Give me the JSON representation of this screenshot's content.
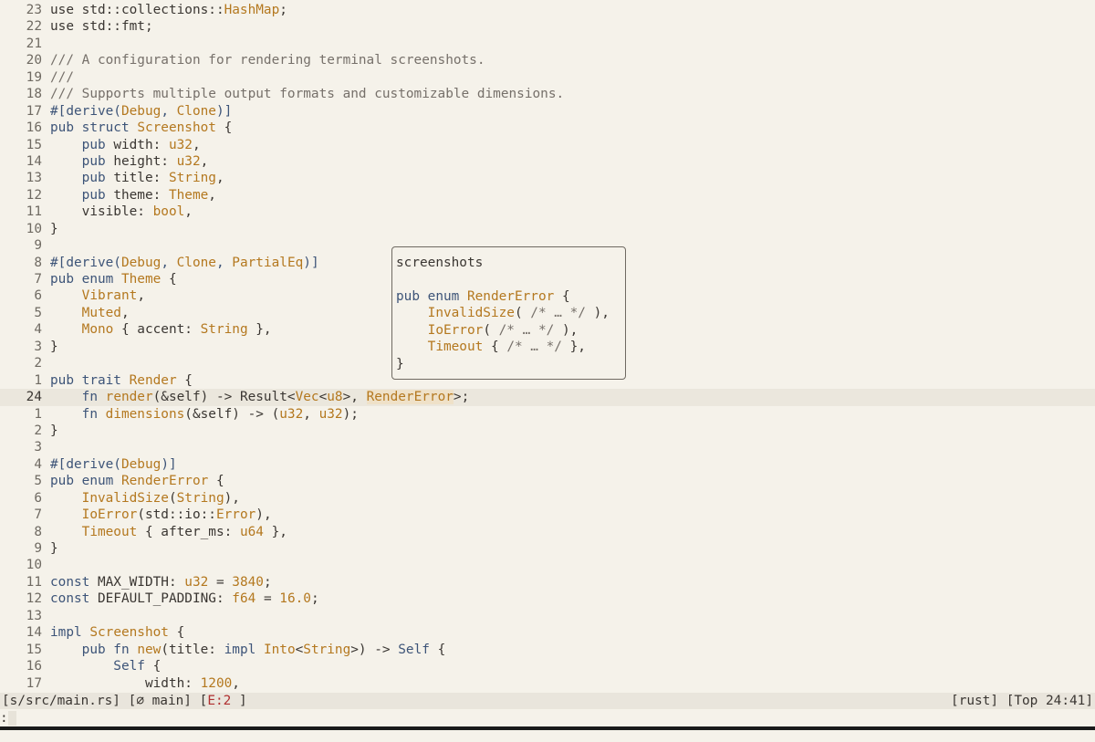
{
  "colors": {
    "background": "#f5f2ea",
    "keyword": "#3d5478",
    "type": "#b4781f",
    "comment": "#76706a",
    "current_line": "#ebe7dd",
    "statusline": "#e9e5dc",
    "error": "#b03030"
  },
  "editor": {
    "current_line_index": 23,
    "lines": [
      {
        "num": "23",
        "tokens": [
          {
            "t": "use std::collections::",
            "c": "plain"
          },
          {
            "t": "HashMap",
            "c": "type"
          },
          {
            "t": ";",
            "c": "plain"
          }
        ]
      },
      {
        "num": "22",
        "tokens": [
          {
            "t": "use std::fmt;",
            "c": "plain"
          }
        ]
      },
      {
        "num": "21",
        "tokens": []
      },
      {
        "num": "20",
        "tokens": [
          {
            "t": "/// A configuration for rendering terminal screenshots.",
            "c": "cmt"
          }
        ]
      },
      {
        "num": "19",
        "tokens": [
          {
            "t": "///",
            "c": "cmt"
          }
        ]
      },
      {
        "num": "18",
        "tokens": [
          {
            "t": "/// Supports multiple output formats and customizable dimensions.",
            "c": "cmt"
          }
        ]
      },
      {
        "num": "17",
        "tokens": [
          {
            "t": "#[derive(",
            "c": "kw"
          },
          {
            "t": "Debug",
            "c": "type"
          },
          {
            "t": ", ",
            "c": "kw"
          },
          {
            "t": "Clone",
            "c": "type"
          },
          {
            "t": ")]",
            "c": "kw"
          }
        ]
      },
      {
        "num": "16",
        "tokens": [
          {
            "t": "pub struct ",
            "c": "kw"
          },
          {
            "t": "Screenshot",
            "c": "type"
          },
          {
            "t": " {",
            "c": "plain"
          }
        ]
      },
      {
        "num": "15",
        "tokens": [
          {
            "t": "    pub ",
            "c": "kw"
          },
          {
            "t": "width: ",
            "c": "plain"
          },
          {
            "t": "u32",
            "c": "type"
          },
          {
            "t": ",",
            "c": "plain"
          }
        ]
      },
      {
        "num": "14",
        "tokens": [
          {
            "t": "    pub ",
            "c": "kw"
          },
          {
            "t": "height: ",
            "c": "plain"
          },
          {
            "t": "u32",
            "c": "type"
          },
          {
            "t": ",",
            "c": "plain"
          }
        ]
      },
      {
        "num": "13",
        "tokens": [
          {
            "t": "    pub ",
            "c": "kw"
          },
          {
            "t": "title: ",
            "c": "plain"
          },
          {
            "t": "String",
            "c": "type"
          },
          {
            "t": ",",
            "c": "plain"
          }
        ]
      },
      {
        "num": "12",
        "tokens": [
          {
            "t": "    pub ",
            "c": "kw"
          },
          {
            "t": "theme: ",
            "c": "plain"
          },
          {
            "t": "Theme",
            "c": "type"
          },
          {
            "t": ",",
            "c": "plain"
          }
        ]
      },
      {
        "num": "11",
        "tokens": [
          {
            "t": "    visible: ",
            "c": "plain"
          },
          {
            "t": "bool",
            "c": "type"
          },
          {
            "t": ",",
            "c": "plain"
          }
        ]
      },
      {
        "num": "10",
        "tokens": [
          {
            "t": "}",
            "c": "plain"
          }
        ]
      },
      {
        "num": "9",
        "tokens": []
      },
      {
        "num": "8",
        "tokens": [
          {
            "t": "#[derive(",
            "c": "kw"
          },
          {
            "t": "Debug",
            "c": "type"
          },
          {
            "t": ", ",
            "c": "kw"
          },
          {
            "t": "Clone",
            "c": "type"
          },
          {
            "t": ", ",
            "c": "kw"
          },
          {
            "t": "PartialEq",
            "c": "type"
          },
          {
            "t": ")]",
            "c": "kw"
          }
        ]
      },
      {
        "num": "7",
        "tokens": [
          {
            "t": "pub enum ",
            "c": "kw"
          },
          {
            "t": "Theme",
            "c": "type"
          },
          {
            "t": " {",
            "c": "plain"
          }
        ]
      },
      {
        "num": "6",
        "tokens": [
          {
            "t": "    Vibrant",
            "c": "type"
          },
          {
            "t": ",",
            "c": "plain"
          }
        ]
      },
      {
        "num": "5",
        "tokens": [
          {
            "t": "    Muted",
            "c": "type"
          },
          {
            "t": ",",
            "c": "plain"
          }
        ]
      },
      {
        "num": "4",
        "tokens": [
          {
            "t": "    Mono",
            "c": "type"
          },
          {
            "t": " { accent: ",
            "c": "plain"
          },
          {
            "t": "String",
            "c": "type"
          },
          {
            "t": " },",
            "c": "plain"
          }
        ]
      },
      {
        "num": "3",
        "tokens": [
          {
            "t": "}",
            "c": "plain"
          }
        ]
      },
      {
        "num": "2",
        "tokens": []
      },
      {
        "num": "1",
        "tokens": [
          {
            "t": "pub trait ",
            "c": "kw"
          },
          {
            "t": "Render",
            "c": "type"
          },
          {
            "t": " {",
            "c": "plain"
          }
        ]
      },
      {
        "num": "24",
        "tokens": [
          {
            "t": "    fn ",
            "c": "kw"
          },
          {
            "t": "render",
            "c": "type"
          },
          {
            "t": "(&self) -> Result<",
            "c": "plain"
          },
          {
            "t": "Vec",
            "c": "type"
          },
          {
            "t": "<",
            "c": "plain"
          },
          {
            "t": "u8",
            "c": "type"
          },
          {
            "t": ">, ",
            "c": "plain"
          },
          {
            "t": "RenderError",
            "c": "hl"
          },
          {
            "t": ">;",
            "c": "plain"
          }
        ]
      },
      {
        "num": "1",
        "tokens": [
          {
            "t": "    fn ",
            "c": "kw"
          },
          {
            "t": "dimensions",
            "c": "type"
          },
          {
            "t": "(&self) -> (",
            "c": "plain"
          },
          {
            "t": "u32",
            "c": "type"
          },
          {
            "t": ", ",
            "c": "plain"
          },
          {
            "t": "u32",
            "c": "type"
          },
          {
            "t": ");",
            "c": "plain"
          }
        ]
      },
      {
        "num": "2",
        "tokens": [
          {
            "t": "}",
            "c": "plain"
          }
        ]
      },
      {
        "num": "3",
        "tokens": []
      },
      {
        "num": "4",
        "tokens": [
          {
            "t": "#[derive(",
            "c": "kw"
          },
          {
            "t": "Debug",
            "c": "type"
          },
          {
            "t": ")]",
            "c": "kw"
          }
        ]
      },
      {
        "num": "5",
        "tokens": [
          {
            "t": "pub enum ",
            "c": "kw"
          },
          {
            "t": "RenderError",
            "c": "type"
          },
          {
            "t": " {",
            "c": "plain"
          }
        ]
      },
      {
        "num": "6",
        "tokens": [
          {
            "t": "    InvalidSize",
            "c": "type"
          },
          {
            "t": "(",
            "c": "plain"
          },
          {
            "t": "String",
            "c": "type"
          },
          {
            "t": "),",
            "c": "plain"
          }
        ]
      },
      {
        "num": "7",
        "tokens": [
          {
            "t": "    IoError",
            "c": "type"
          },
          {
            "t": "(std::io::",
            "c": "plain"
          },
          {
            "t": "Error",
            "c": "type"
          },
          {
            "t": "),",
            "c": "plain"
          }
        ]
      },
      {
        "num": "8",
        "tokens": [
          {
            "t": "    Timeout",
            "c": "type"
          },
          {
            "t": " { after_ms: ",
            "c": "plain"
          },
          {
            "t": "u64",
            "c": "type"
          },
          {
            "t": " },",
            "c": "plain"
          }
        ]
      },
      {
        "num": "9",
        "tokens": [
          {
            "t": "}",
            "c": "plain"
          }
        ]
      },
      {
        "num": "10",
        "tokens": []
      },
      {
        "num": "11",
        "tokens": [
          {
            "t": "const ",
            "c": "kw"
          },
          {
            "t": "MAX_WIDTH: ",
            "c": "plain"
          },
          {
            "t": "u32",
            "c": "type"
          },
          {
            "t": " = ",
            "c": "plain"
          },
          {
            "t": "3840",
            "c": "num"
          },
          {
            "t": ";",
            "c": "plain"
          }
        ]
      },
      {
        "num": "12",
        "tokens": [
          {
            "t": "const ",
            "c": "kw"
          },
          {
            "t": "DEFAULT_PADDING: ",
            "c": "plain"
          },
          {
            "t": "f64",
            "c": "type"
          },
          {
            "t": " = ",
            "c": "plain"
          },
          {
            "t": "16.0",
            "c": "num"
          },
          {
            "t": ";",
            "c": "plain"
          }
        ]
      },
      {
        "num": "13",
        "tokens": []
      },
      {
        "num": "14",
        "tokens": [
          {
            "t": "impl ",
            "c": "kw"
          },
          {
            "t": "Screenshot",
            "c": "type"
          },
          {
            "t": " {",
            "c": "plain"
          }
        ]
      },
      {
        "num": "15",
        "tokens": [
          {
            "t": "    pub fn ",
            "c": "kw"
          },
          {
            "t": "new",
            "c": "type"
          },
          {
            "t": "(title: ",
            "c": "plain"
          },
          {
            "t": "impl ",
            "c": "kw"
          },
          {
            "t": "Into",
            "c": "type"
          },
          {
            "t": "<",
            "c": "plain"
          },
          {
            "t": "String",
            "c": "type"
          },
          {
            "t": ">) -> ",
            "c": "plain"
          },
          {
            "t": "Self",
            "c": "kw"
          },
          {
            "t": " {",
            "c": "plain"
          }
        ]
      },
      {
        "num": "16",
        "tokens": [
          {
            "t": "        Self",
            "c": "kw"
          },
          {
            "t": " {",
            "c": "plain"
          }
        ]
      },
      {
        "num": "17",
        "tokens": [
          {
            "t": "            width: ",
            "c": "plain"
          },
          {
            "t": "1200",
            "c": "num"
          },
          {
            "t": ",",
            "c": "plain"
          }
        ]
      }
    ]
  },
  "hover": {
    "lines": [
      {
        "tokens": [
          {
            "t": "screenshots",
            "c": "plain"
          }
        ]
      },
      {
        "tokens": []
      },
      {
        "tokens": [
          {
            "t": "pub enum ",
            "c": "kw"
          },
          {
            "t": "RenderError",
            "c": "type"
          },
          {
            "t": " {",
            "c": "plain"
          }
        ]
      },
      {
        "tokens": [
          {
            "t": "    InvalidSize",
            "c": "type"
          },
          {
            "t": "( ",
            "c": "plain"
          },
          {
            "t": "/* … */",
            "c": "cmt"
          },
          {
            "t": " ),",
            "c": "plain"
          }
        ]
      },
      {
        "tokens": [
          {
            "t": "    IoError",
            "c": "type"
          },
          {
            "t": "( ",
            "c": "plain"
          },
          {
            "t": "/* … */",
            "c": "cmt"
          },
          {
            "t": " ),",
            "c": "plain"
          }
        ]
      },
      {
        "tokens": [
          {
            "t": "    Timeout",
            "c": "type"
          },
          {
            "t": " { ",
            "c": "plain"
          },
          {
            "t": "/* … */",
            "c": "cmt"
          },
          {
            "t": " },",
            "c": "plain"
          }
        ]
      },
      {
        "tokens": [
          {
            "t": "}",
            "c": "plain"
          }
        ]
      }
    ]
  },
  "statusline": {
    "file": "[s/src/main.rs]",
    "branch": "[",
    "branch_icon": "⌀",
    "branch_name": " main]",
    "errors_open": "[",
    "errors": "E:2",
    "errors_close": " ]",
    "filetype": "[rust]",
    "position": "[Top 24:41]"
  },
  "cmdline": {
    "prompt": ":"
  }
}
